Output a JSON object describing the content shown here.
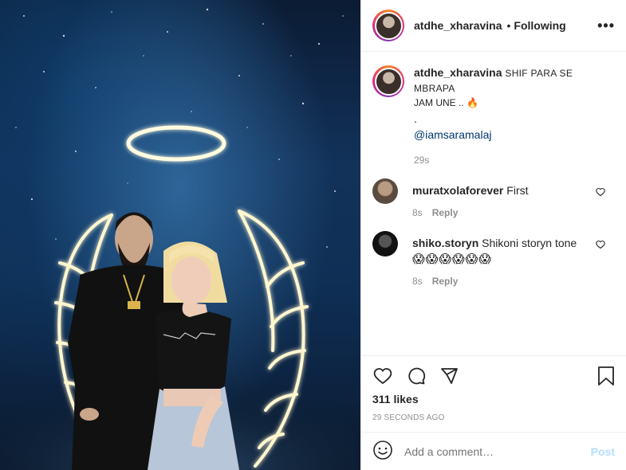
{
  "post": {
    "author": "atdhe_xharavina",
    "follow_status": "Following",
    "separator": "•",
    "more_icon": "more-horizontal-icon"
  },
  "caption": {
    "user": "atdhe_xharavina",
    "text_line1": "SHIF PARA SE MBRAPA",
    "text_line2": "JAM UNE ..",
    "emoji": "🔥",
    "dot_line": ".",
    "mention": "@iamsaramalaj",
    "time": "29s"
  },
  "comments": [
    {
      "user": "muratxolaforever",
      "text": "First",
      "time": "8s",
      "reply": "Reply"
    },
    {
      "user": "shiko.storyn",
      "text": "Shikoni storyn tone",
      "emoji": "😱😱😱😱😱😱",
      "time": "8s",
      "reply": "Reply"
    }
  ],
  "engagement": {
    "likes": "311 likes",
    "timestamp": "29 SECONDS AGO"
  },
  "add_comment": {
    "placeholder": "Add a comment…",
    "post_label": "Post"
  },
  "colors": {
    "text": "#262626",
    "muted": "#8e8e8e",
    "link": "#00376b",
    "post_disabled": "#b2dffc",
    "border": "#efefef"
  }
}
